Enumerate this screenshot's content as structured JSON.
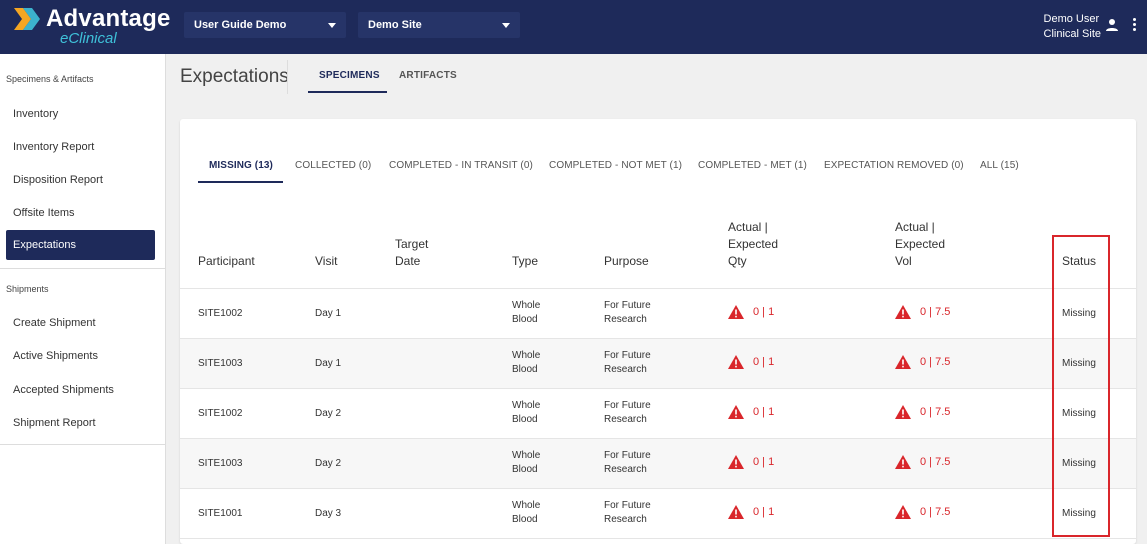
{
  "brand": {
    "name": "Advantage",
    "sub": "eClinical",
    "accent": "#3fc1d9",
    "navy": "#1e2a5a"
  },
  "header": {
    "study_select": "User Guide Demo",
    "site_select": "Demo Site",
    "user_name": "Demo User",
    "user_site": "Clinical Site",
    "user_icon": "person-icon",
    "menu_icon": "more-vert-icon"
  },
  "sidebar": {
    "section1": "Specimens & Artifacts",
    "items1": [
      "Inventory",
      "Inventory Report",
      "Disposition Report",
      "Offsite Items",
      "Expectations"
    ],
    "section2": "Shipments",
    "items2": [
      "Create Shipment",
      "Active Shipments",
      "Accepted Shipments",
      "Shipment Report"
    ],
    "active": "Expectations"
  },
  "page": {
    "title": "Expectations",
    "tabs": [
      "SPECIMENS",
      "ARTIFACTS"
    ],
    "active_tab": "SPECIMENS"
  },
  "status_tabs": [
    "MISSING (13)",
    "COLLECTED (0)",
    "COMPLETED - IN TRANSIT (0)",
    "COMPLETED - NOT MET (1)",
    "COMPLETED - MET (1)",
    "EXPECTATION REMOVED (0)",
    "ALL (15)"
  ],
  "table": {
    "columns": {
      "participant": "Participant",
      "visit": "Visit",
      "target_l1": "Target",
      "target_l2": "Date",
      "type": "Type",
      "purpose": "Purpose",
      "qty_l1": "Actual |",
      "qty_l2": "Expected",
      "qty_l3": "Qty",
      "vol_l1": "Actual |",
      "vol_l2": "Expected",
      "vol_l3": "Vol",
      "status": "Status"
    },
    "rows": [
      {
        "participant": "SITE1002",
        "visit": "Day 1",
        "type1": "Whole",
        "type2": "Blood",
        "purpose1": "For Future",
        "purpose2": "Research",
        "qty": "0 | 1",
        "vol": "0 | 7.5",
        "status": "Missing"
      },
      {
        "participant": "SITE1003",
        "visit": "Day 1",
        "type1": "Whole",
        "type2": "Blood",
        "purpose1": "For Future",
        "purpose2": "Research",
        "qty": "0 | 1",
        "vol": "0 | 7.5",
        "status": "Missing"
      },
      {
        "participant": "SITE1002",
        "visit": "Day 2",
        "type1": "Whole",
        "type2": "Blood",
        "purpose1": "For Future",
        "purpose2": "Research",
        "qty": "0 | 1",
        "vol": "0 | 7.5",
        "status": "Missing"
      },
      {
        "participant": "SITE1003",
        "visit": "Day 2",
        "type1": "Whole",
        "type2": "Blood",
        "purpose1": "For Future",
        "purpose2": "Research",
        "qty": "0 | 1",
        "vol": "0 | 7.5",
        "status": "Missing"
      },
      {
        "participant": "SITE1001",
        "visit": "Day 3",
        "type1": "Whole",
        "type2": "Blood",
        "purpose1": "For Future",
        "purpose2": "Research",
        "qty": "0 | 1",
        "vol": "0 | 7.5",
        "status": "Missing"
      }
    ],
    "warning_icon": "warning-triangle-icon",
    "warning_color": "#d9262b"
  }
}
